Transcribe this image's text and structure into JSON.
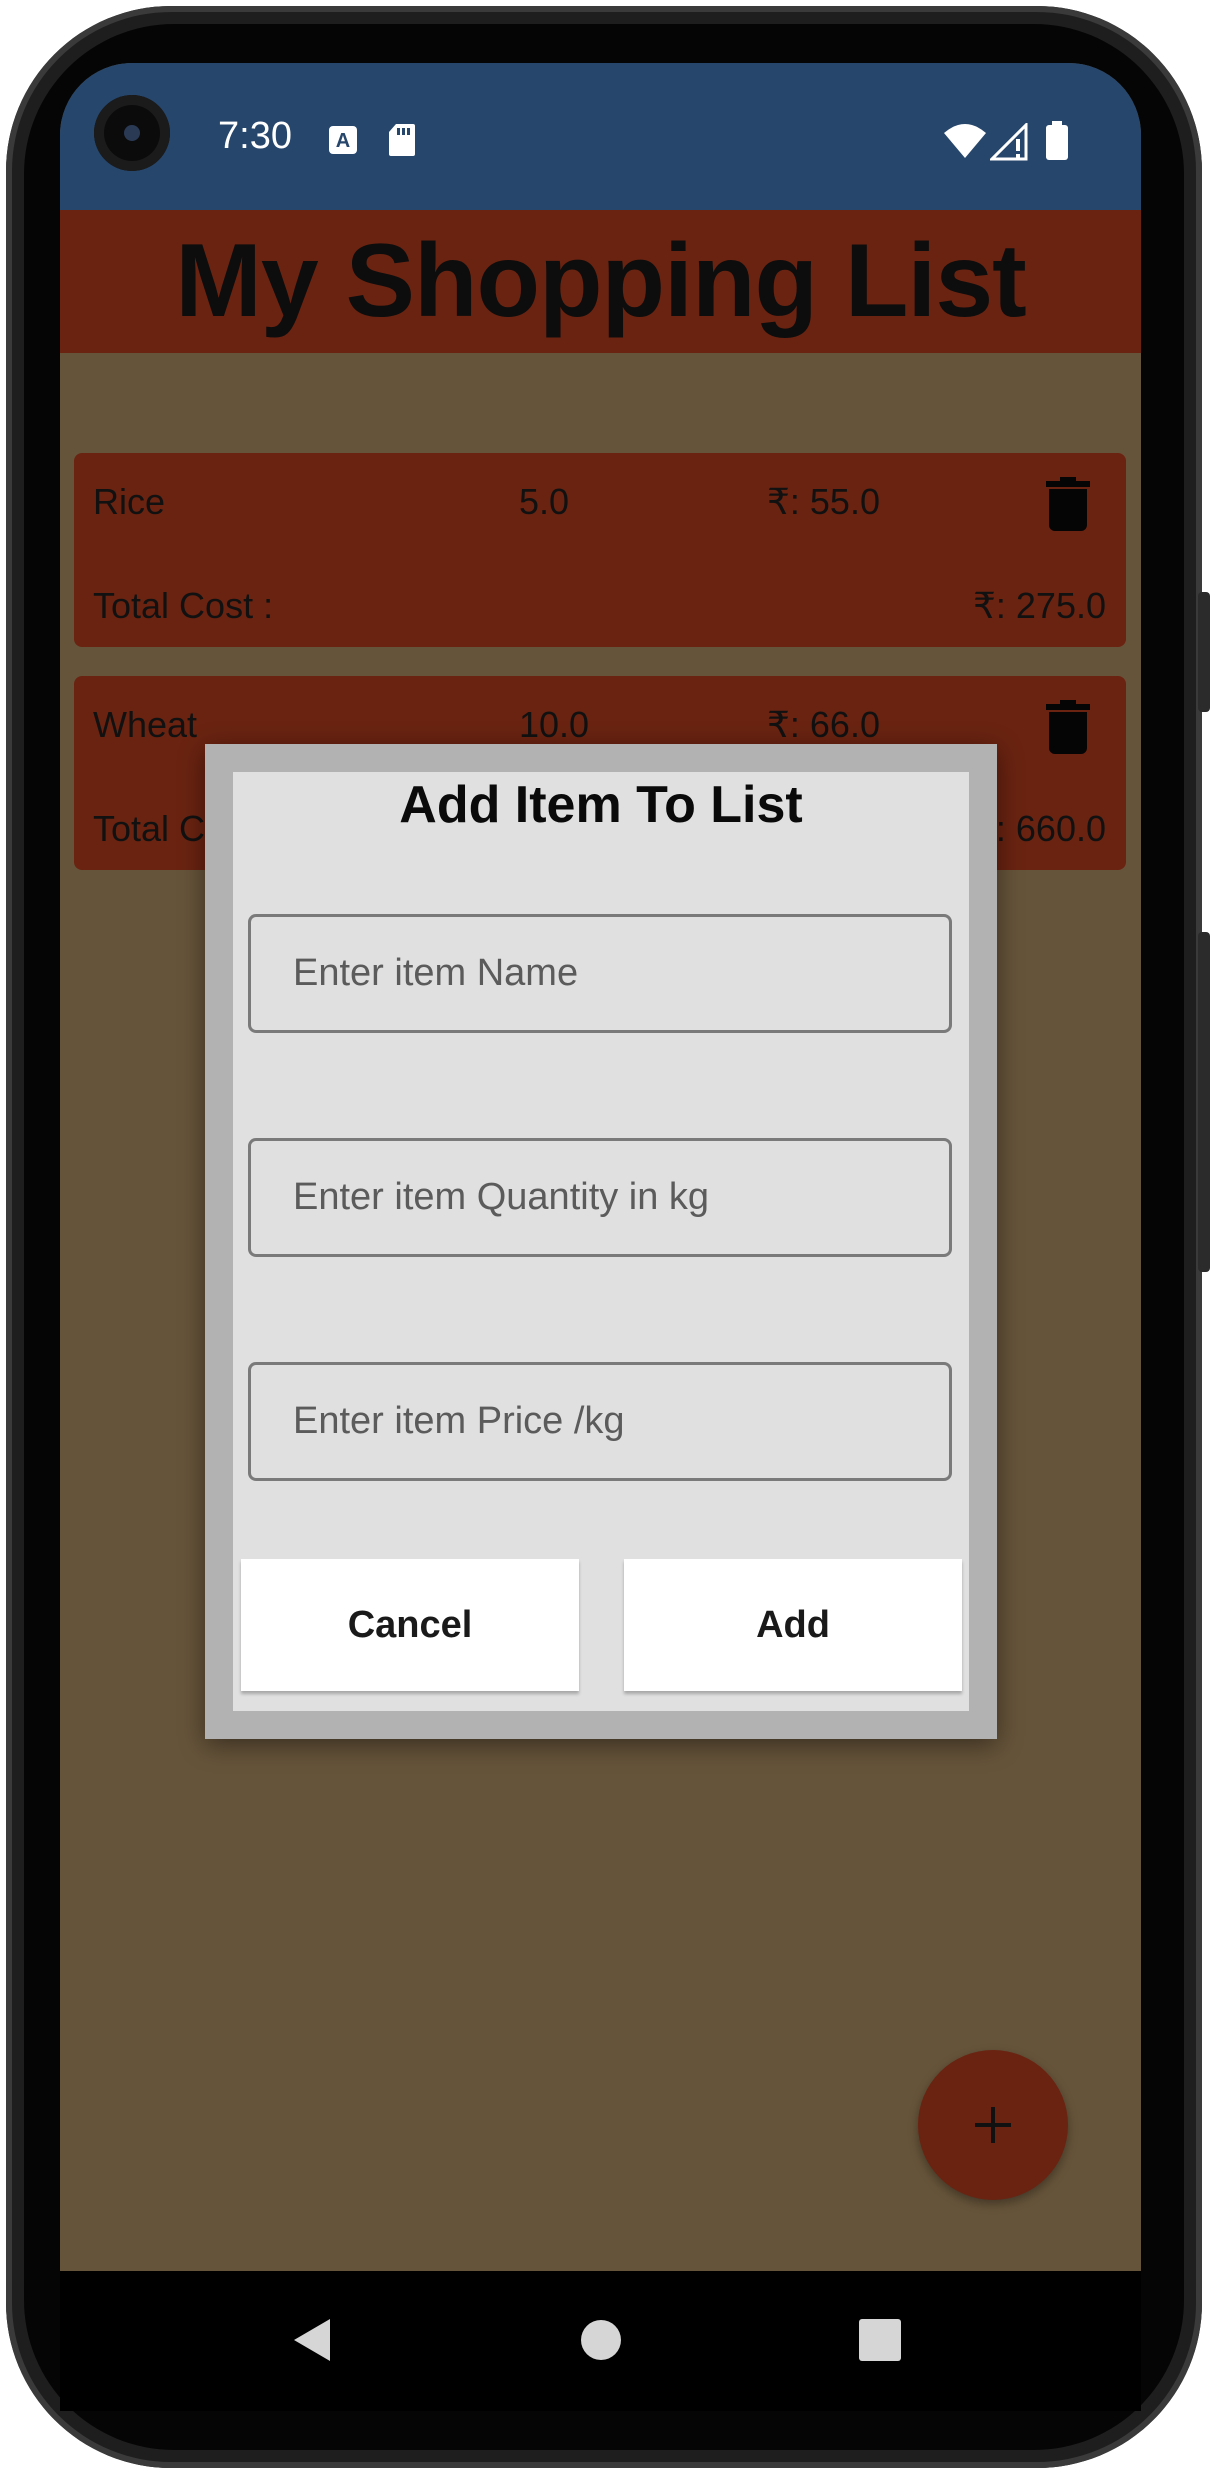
{
  "status_bar": {
    "time": "7:30",
    "icons": [
      "a-letter-notification-icon",
      "sd-card-icon",
      "wifi-icon",
      "cell-signal-icon",
      "battery-icon"
    ]
  },
  "header": {
    "title": "My Shopping List"
  },
  "list": {
    "items": [
      {
        "name": "Rice",
        "quantity": "5.0",
        "price": "₹: 55.0",
        "total_label": "Total Cost :",
        "total_value": "₹: 275.0"
      },
      {
        "name": "Wheat",
        "quantity": "10.0",
        "price": "₹: 66.0",
        "total_label": "Total Cost :",
        "total_value": "₹: 660.0"
      }
    ]
  },
  "dialog": {
    "title": "Add Item To List",
    "name_field": {
      "value": "",
      "placeholder": "Enter item Name"
    },
    "quantity_field": {
      "value": "",
      "placeholder": "Enter item Quantity in kg"
    },
    "price_field": {
      "value": "",
      "placeholder": "Enter item Price /kg"
    },
    "cancel_label": "Cancel",
    "add_label": "Add"
  },
  "fab": {
    "icon": "plus-icon"
  },
  "nav": {
    "icons": [
      "back-icon",
      "home-icon",
      "recents-icon"
    ]
  },
  "colors": {
    "status_bar": "#27466b",
    "header": "#6a2311",
    "background": "#66543a",
    "dialog": "#e0e0e0"
  }
}
